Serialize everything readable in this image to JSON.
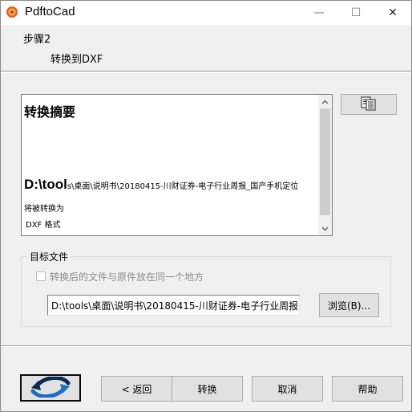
{
  "window": {
    "title": "PdftoCad",
    "minimize_glyph": "—",
    "maximize_glyph": "☐",
    "close_glyph": "✕"
  },
  "header": {
    "step": "步骤2",
    "subtitle": "转换到DXF"
  },
  "summary": {
    "title": "转换摘要",
    "path_prefix": "D:\\tool",
    "path_rest": "s\\桌面\\说明书\\20180415-川财证券-电子行业周报_国产手机定位",
    "convert_label": "将被转换为",
    "format_label": "DXF 格式"
  },
  "target_group": {
    "legend": "目标文件",
    "checkbox_label": "转换后的文件与原件放在同一个地方",
    "checkbox_checked": false,
    "checkbox_enabled": false,
    "path_value": "D:\\tools\\桌面\\说明书\\20180415-川财证券-电子行业周报",
    "browse_label": "浏览(B)..."
  },
  "footer": {
    "back_label": "< 返回",
    "convert_label": "转换",
    "cancel_label": "取消",
    "help_label": "帮助"
  },
  "icons": {
    "app": "pdftocad-app-icon",
    "copy": "copy-icon",
    "logo": "refresh-arrows-logo-icon"
  },
  "colors": {
    "logo_blue": "#1b6fc4",
    "logo_dark": "#0d2a55"
  }
}
